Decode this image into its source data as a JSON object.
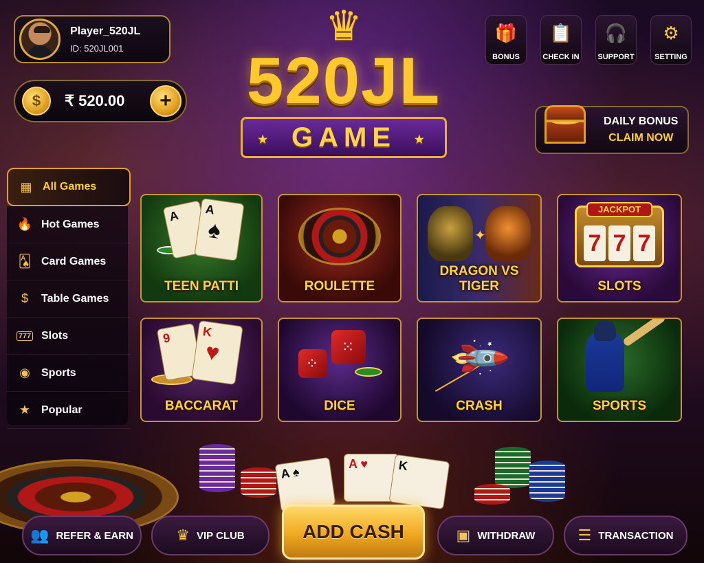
{
  "player": {
    "name": "Player_520JL",
    "id": "ID: 520JL001"
  },
  "balance": {
    "currency_symbol": "₹",
    "amount": "₹ 520.00",
    "coin_symbol": "$",
    "add_symbol": "+"
  },
  "logo": {
    "crown": "♛",
    "title": "520JL",
    "subtitle": "GAME"
  },
  "top_icons": [
    {
      "label": "BONUS",
      "icon": "gift-icon",
      "glyph": "🎁"
    },
    {
      "label": "CHECK IN",
      "icon": "clipboard-check-icon",
      "glyph": "📋"
    },
    {
      "label": "SUPPORT",
      "icon": "headset-icon",
      "glyph": "🎧"
    },
    {
      "label": "SETTING",
      "icon": "gear-icon",
      "glyph": "⚙"
    }
  ],
  "daily_bonus": {
    "line1": "DAILY BONUS",
    "line2": "CLAIM NOW",
    "icon": "treasure-chest-icon"
  },
  "sidebar": {
    "items": [
      {
        "label": "All Games",
        "icon": "grid-icon",
        "glyph": "▦",
        "active": true
      },
      {
        "label": "Hot Games",
        "icon": "flame-icon",
        "glyph": "🔥"
      },
      {
        "label": "Card Games",
        "icon": "cards-icon",
        "glyph": "🂡"
      },
      {
        "label": "Table Games",
        "icon": "dollar-coin-icon",
        "glyph": "$"
      },
      {
        "label": "Slots",
        "icon": "slot-777-icon",
        "glyph": "777"
      },
      {
        "label": "Sports",
        "icon": "ball-icon",
        "glyph": "◉"
      },
      {
        "label": "Popular",
        "icon": "star-icon",
        "glyph": "★"
      }
    ]
  },
  "games": [
    {
      "label": "TEEN PATTI",
      "art": "cards"
    },
    {
      "label": "ROULETTE",
      "art": "roulette"
    },
    {
      "label": "DRAGON VS TIGER",
      "art": "dragon-tiger"
    },
    {
      "label": "SLOTS",
      "art": "slot-machine"
    },
    {
      "label": "BACCARAT",
      "art": "cards-9k"
    },
    {
      "label": "DICE",
      "art": "dice"
    },
    {
      "label": "CRASH",
      "art": "rocket"
    },
    {
      "label": "SPORTS",
      "art": "cricket"
    }
  ],
  "art_text": {
    "ace": "A",
    "spade": "♠",
    "heart": "♥",
    "nine": "9",
    "king": "K",
    "jackpot": "JACKPOT",
    "seven": "7",
    "vs_spark": "✦",
    "dice_face_1": "⁘",
    "dice_face_2": "⁙",
    "rocket": "🚀"
  },
  "bottom_bar": {
    "refer": {
      "label": "REFER & EARN",
      "icon": "users-icon",
      "glyph": "👥"
    },
    "vip": {
      "label": "VIP CLUB",
      "icon": "crown-icon",
      "glyph": "♛"
    },
    "add_cash": {
      "label": "ADD CASH"
    },
    "withdraw": {
      "label": "WITHDRAW",
      "icon": "wallet-icon",
      "glyph": "▣"
    },
    "transaction": {
      "label": "TRANSACTION",
      "icon": "receipt-icon",
      "glyph": "☰"
    }
  },
  "colors": {
    "gold": "#ffcf3a",
    "purple": "#3a0f5c",
    "accent_border": "#c9942a"
  }
}
